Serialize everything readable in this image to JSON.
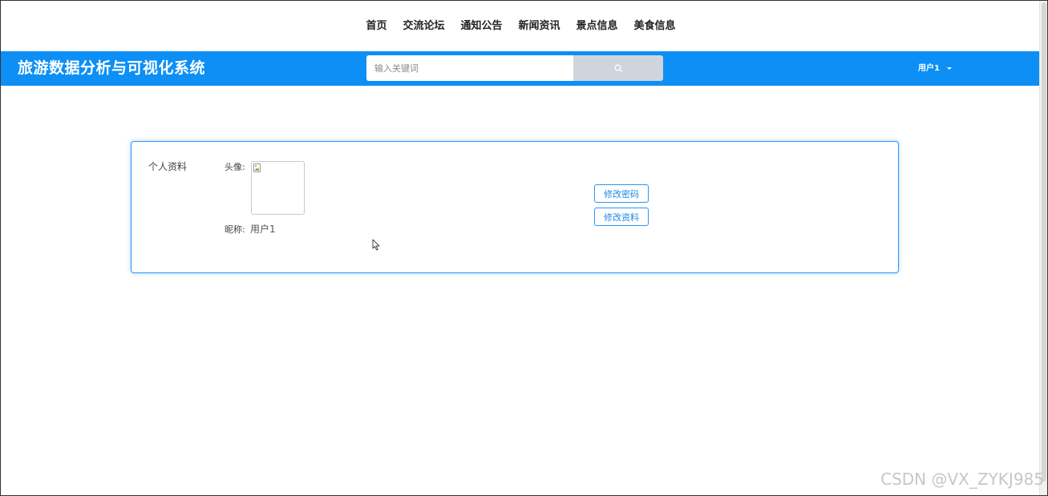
{
  "nav": {
    "items": [
      {
        "label": "首页"
      },
      {
        "label": "交流论坛"
      },
      {
        "label": "通知公告"
      },
      {
        "label": "新闻资讯"
      },
      {
        "label": "景点信息"
      },
      {
        "label": "美食信息"
      }
    ]
  },
  "header": {
    "brand": "旅游数据分析与可视化系统",
    "search": {
      "placeholder": "输入关键词",
      "value": ""
    },
    "user": {
      "name": "用户1"
    }
  },
  "profile": {
    "title": "个人资料",
    "avatar_label": "头像:",
    "nickname_label": "昵称:",
    "nickname_value": "用户1",
    "change_password_label": "修改密码",
    "edit_profile_label": "修改资料"
  },
  "watermark": "CSDN @VX_ZYKJ985",
  "colors": {
    "primary": "#0d8ff5",
    "search_button": "#cfd5dc",
    "button_border": "#2d95f5"
  },
  "icons": {
    "search": "search-icon",
    "dropdown": "chevron-down-icon",
    "avatar_placeholder": "broken-image-icon",
    "cursor": "mouse-pointer-icon"
  }
}
